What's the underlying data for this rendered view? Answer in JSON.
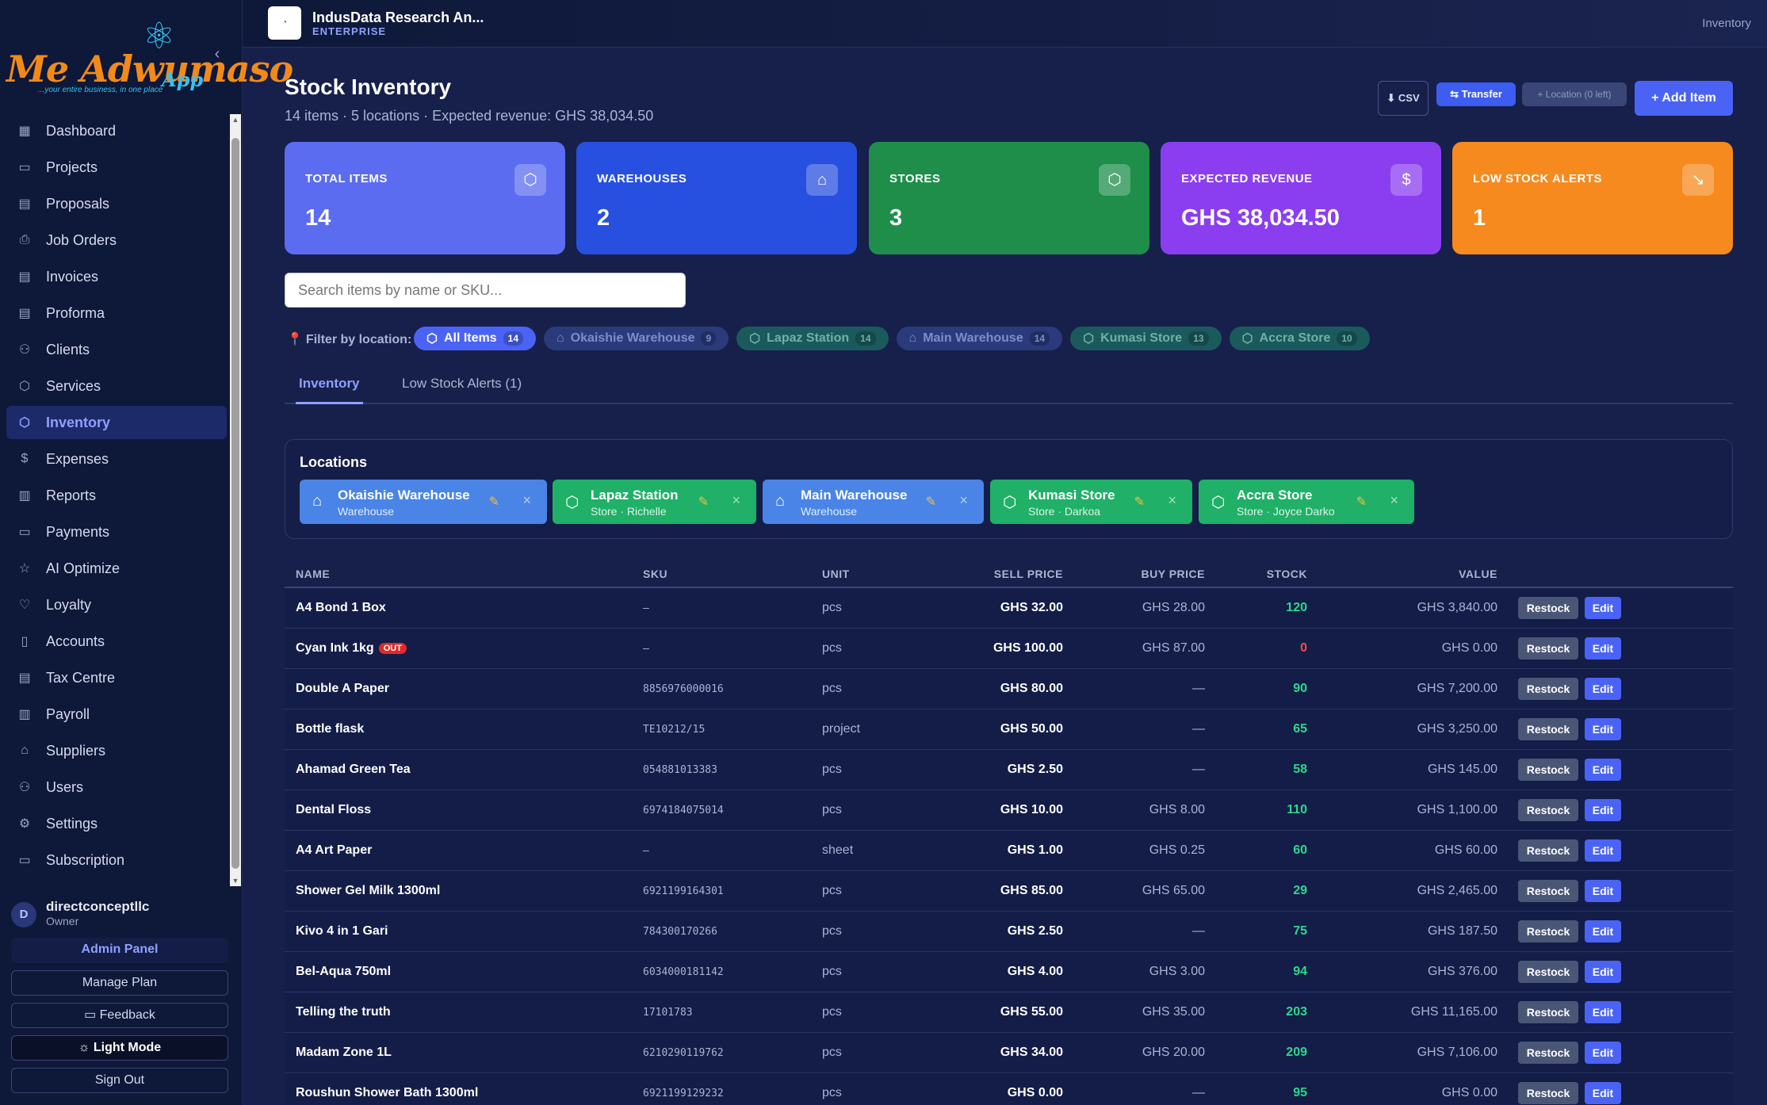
{
  "logo": {
    "text": "Me Adwumaso",
    "app": "App",
    "tagline": "...your entire business, in one place"
  },
  "sidebar": {
    "items": [
      {
        "label": "Dashboard",
        "icon": "dashboard-icon",
        "glyph": "▦"
      },
      {
        "label": "Projects",
        "icon": "folder-icon",
        "glyph": "▭"
      },
      {
        "label": "Proposals",
        "icon": "document-icon",
        "glyph": "▤"
      },
      {
        "label": "Job Orders",
        "icon": "printer-icon",
        "glyph": "⎙"
      },
      {
        "label": "Invoices",
        "icon": "invoice-icon",
        "glyph": "▤"
      },
      {
        "label": "Proforma",
        "icon": "proforma-icon",
        "glyph": "▤"
      },
      {
        "label": "Clients",
        "icon": "users-icon",
        "glyph": "⚇"
      },
      {
        "label": "Services",
        "icon": "box-icon",
        "glyph": "⬡"
      },
      {
        "label": "Inventory",
        "icon": "inventory-icon",
        "glyph": "⬡",
        "active": true
      },
      {
        "label": "Expenses",
        "icon": "dollar-icon",
        "glyph": "$"
      },
      {
        "label": "Reports",
        "icon": "bar-chart-icon",
        "glyph": "▥"
      },
      {
        "label": "Payments",
        "icon": "credit-card-icon",
        "glyph": "▭"
      },
      {
        "label": "AI Optimize",
        "icon": "star-icon",
        "glyph": "☆"
      },
      {
        "label": "Loyalty",
        "icon": "heart-icon",
        "glyph": "♡"
      },
      {
        "label": "Accounts",
        "icon": "book-icon",
        "glyph": "▯"
      },
      {
        "label": "Tax Centre",
        "icon": "tax-icon",
        "glyph": "▤"
      },
      {
        "label": "Payroll",
        "icon": "payroll-icon",
        "glyph": "▥"
      },
      {
        "label": "Suppliers",
        "icon": "suppliers-icon",
        "glyph": "⌂"
      },
      {
        "label": "Users",
        "icon": "user-icon",
        "glyph": "⚇"
      },
      {
        "label": "Settings",
        "icon": "gear-icon",
        "glyph": "⚙"
      },
      {
        "label": "Subscription",
        "icon": "subscription-icon",
        "glyph": "▭"
      }
    ],
    "user": {
      "initial": "D",
      "name": "directconceptllc",
      "role": "Owner"
    },
    "admin_panel": "Admin Panel",
    "manage_plan": "Manage Plan",
    "feedback": "Feedback",
    "light_mode": "Light Mode",
    "sign_out": "Sign Out"
  },
  "topbar": {
    "org_name": "IndusData Research An...",
    "org_plan": "ENTERPRISE",
    "breadcrumb": "Inventory"
  },
  "page": {
    "title": "Stock Inventory",
    "subtitle": "14 items · 5 locations · Expected revenue: GHS 38,034.50",
    "csv": "⬇ CSV",
    "transfer": "⇆ Transfer",
    "location": "+ Location (0 left)",
    "add_item": "+ Add Item"
  },
  "cards": [
    {
      "label": "TOTAL ITEMS",
      "value": "14",
      "color": "#5b6cf0",
      "icon": "package-icon",
      "glyph": "⬡"
    },
    {
      "label": "WAREHOUSES",
      "value": "2",
      "color": "#2750e0",
      "icon": "warehouse-icon",
      "glyph": "⌂"
    },
    {
      "label": "STORES",
      "value": "3",
      "color": "#1e8e4a",
      "icon": "store-icon",
      "glyph": "⬡"
    },
    {
      "label": "EXPECTED REVENUE",
      "value": "GHS 38,034.50",
      "color": "#8a3ef0",
      "icon": "dollar-icon",
      "glyph": "$"
    },
    {
      "label": "LOW STOCK ALERTS",
      "value": "1",
      "color": "#f68a1e",
      "icon": "trending-down-icon",
      "glyph": "↘"
    }
  ],
  "search": {
    "placeholder": "Search items by name or SKU..."
  },
  "filter": {
    "label": "Filter by location:",
    "chips": [
      {
        "label": "All Items",
        "count": "14",
        "kind": "active",
        "glyph": "⬡"
      },
      {
        "label": "Okaishie Warehouse",
        "count": "9",
        "kind": "wh",
        "glyph": "⌂"
      },
      {
        "label": "Lapaz Station",
        "count": "14",
        "kind": "st",
        "glyph": "⬡"
      },
      {
        "label": "Main Warehouse",
        "count": "14",
        "kind": "wh",
        "glyph": "⌂"
      },
      {
        "label": "Kumasi Store",
        "count": "13",
        "kind": "st",
        "glyph": "⬡"
      },
      {
        "label": "Accra Store",
        "count": "10",
        "kind": "st",
        "glyph": "⬡"
      }
    ]
  },
  "tabs": [
    {
      "label": "Inventory",
      "active": true
    },
    {
      "label": "Low Stock Alerts (1)",
      "active": false
    }
  ],
  "locations": {
    "title": "Locations",
    "items": [
      {
        "name": "Okaishie Warehouse",
        "type": "Warehouse",
        "kind": "wh"
      },
      {
        "name": "Lapaz Station",
        "type": "Store · Richelle",
        "kind": "st"
      },
      {
        "name": "Main Warehouse",
        "type": "Warehouse",
        "kind": "wh"
      },
      {
        "name": "Kumasi Store",
        "type": "Store · Darkoa",
        "kind": "st"
      },
      {
        "name": "Accra Store",
        "type": "Store · Joyce Darko",
        "kind": "st"
      }
    ]
  },
  "table": {
    "headers": {
      "name": "NAME",
      "sku": "SKU",
      "unit": "UNIT",
      "sell": "SELL PRICE",
      "buy": "BUY PRICE",
      "stock": "STOCK",
      "value": "VALUE"
    },
    "restock": "Restock",
    "edit": "Edit",
    "out_badge": "OUT",
    "rows": [
      {
        "name": "A4 Bond 1 Box",
        "sku": "–",
        "unit": "pcs",
        "sell": "GHS 32.00",
        "buy": "GHS 28.00",
        "stock": "120",
        "value": "GHS 3,840.00"
      },
      {
        "name": "Cyan Ink 1kg",
        "out": true,
        "sku": "–",
        "unit": "pcs",
        "sell": "GHS 100.00",
        "buy": "GHS 87.00",
        "stock": "0",
        "value": "GHS 0.00"
      },
      {
        "name": "Double A Paper",
        "sku": "8856976000016",
        "unit": "pcs",
        "sell": "GHS 80.00",
        "buy": "—",
        "stock": "90",
        "value": "GHS 7,200.00"
      },
      {
        "name": "Bottle flask",
        "sku": "TE10212/15",
        "unit": "project",
        "sell": "GHS 50.00",
        "buy": "—",
        "stock": "65",
        "value": "GHS 3,250.00"
      },
      {
        "name": "Ahamad Green Tea",
        "sku": "054881013383",
        "unit": "pcs",
        "sell": "GHS 2.50",
        "buy": "—",
        "stock": "58",
        "value": "GHS 145.00"
      },
      {
        "name": "Dental Floss",
        "sku": "6974184075014",
        "unit": "pcs",
        "sell": "GHS 10.00",
        "buy": "GHS 8.00",
        "stock": "110",
        "value": "GHS 1,100.00"
      },
      {
        "name": "A4 Art Paper",
        "sku": "–",
        "unit": "sheet",
        "sell": "GHS 1.00",
        "buy": "GHS 0.25",
        "stock": "60",
        "value": "GHS 60.00"
      },
      {
        "name": "Shower Gel Milk 1300ml",
        "sku": "6921199164301",
        "unit": "pcs",
        "sell": "GHS 85.00",
        "buy": "GHS 65.00",
        "stock": "29",
        "value": "GHS 2,465.00"
      },
      {
        "name": "Kivo 4 in 1 Gari",
        "sku": "784300170266",
        "unit": "pcs",
        "sell": "GHS 2.50",
        "buy": "—",
        "stock": "75",
        "value": "GHS 187.50"
      },
      {
        "name": "Bel-Aqua 750ml",
        "sku": "6034000181142",
        "unit": "pcs",
        "sell": "GHS 4.00",
        "buy": "GHS 3.00",
        "stock": "94",
        "value": "GHS 376.00"
      },
      {
        "name": "Telling the truth",
        "sku": "17101783",
        "unit": "pcs",
        "sell": "GHS 55.00",
        "buy": "GHS 35.00",
        "stock": "203",
        "value": "GHS 11,165.00"
      },
      {
        "name": "Madam Zone 1L",
        "sku": "6210290119762",
        "unit": "pcs",
        "sell": "GHS 34.00",
        "buy": "GHS 20.00",
        "stock": "209",
        "value": "GHS 7,106.00"
      },
      {
        "name": "Roushun Shower Bath 1300ml",
        "sku": "6921199129232",
        "unit": "pcs",
        "sell": "GHS 0.00",
        "buy": "—",
        "stock": "95",
        "value": "GHS 0.00"
      }
    ]
  }
}
